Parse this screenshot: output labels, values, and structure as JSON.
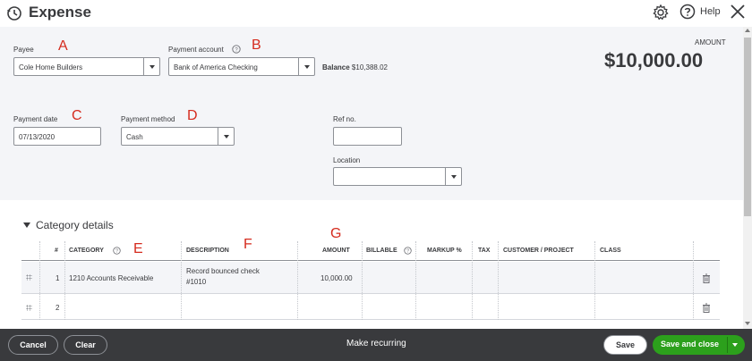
{
  "header": {
    "title": "Expense",
    "help_label": "Help",
    "icons": [
      "history-icon",
      "gear-icon",
      "help-icon",
      "close-icon"
    ]
  },
  "annotations": [
    "A",
    "B",
    "C",
    "D",
    "E",
    "F",
    "G"
  ],
  "form": {
    "payee": {
      "label": "Payee",
      "value": "Cole Home Builders"
    },
    "payment_account": {
      "label": "Payment account",
      "value": "Bank of America Checking"
    },
    "balance": {
      "label": "Balance",
      "value": "$10,388.02"
    },
    "amount": {
      "label": "AMOUNT",
      "value": "$10,000.00"
    },
    "payment_date": {
      "label": "Payment date",
      "value": "07/13/2020"
    },
    "payment_method": {
      "label": "Payment method",
      "value": "Cash"
    },
    "ref_no": {
      "label": "Ref no.",
      "value": ""
    },
    "location": {
      "label": "Location",
      "value": ""
    }
  },
  "category_details": {
    "title": "Category details",
    "columns": [
      "#",
      "CATEGORY",
      "DESCRIPTION",
      "AMOUNT",
      "BILLABLE",
      "MARKUP %",
      "TAX",
      "CUSTOMER / PROJECT",
      "CLASS"
    ],
    "rows": [
      {
        "num": "1",
        "category": "1210 Accounts Receivable",
        "description_line1": "Record bounced check",
        "description_line2": "#1010",
        "amount": "10,000.00"
      },
      {
        "num": "2",
        "category": "",
        "description_line1": "",
        "description_line2": "",
        "amount": ""
      }
    ]
  },
  "footer": {
    "cancel": "Cancel",
    "clear": "Clear",
    "make_recurring": "Make recurring",
    "save": "Save",
    "save_and_close": "Save and close"
  },
  "colors": {
    "accent_green": "#2ca01c",
    "footer_bg": "#393a3d",
    "form_bg": "#f4f5f8",
    "annotation_red": "#d52b1e"
  }
}
